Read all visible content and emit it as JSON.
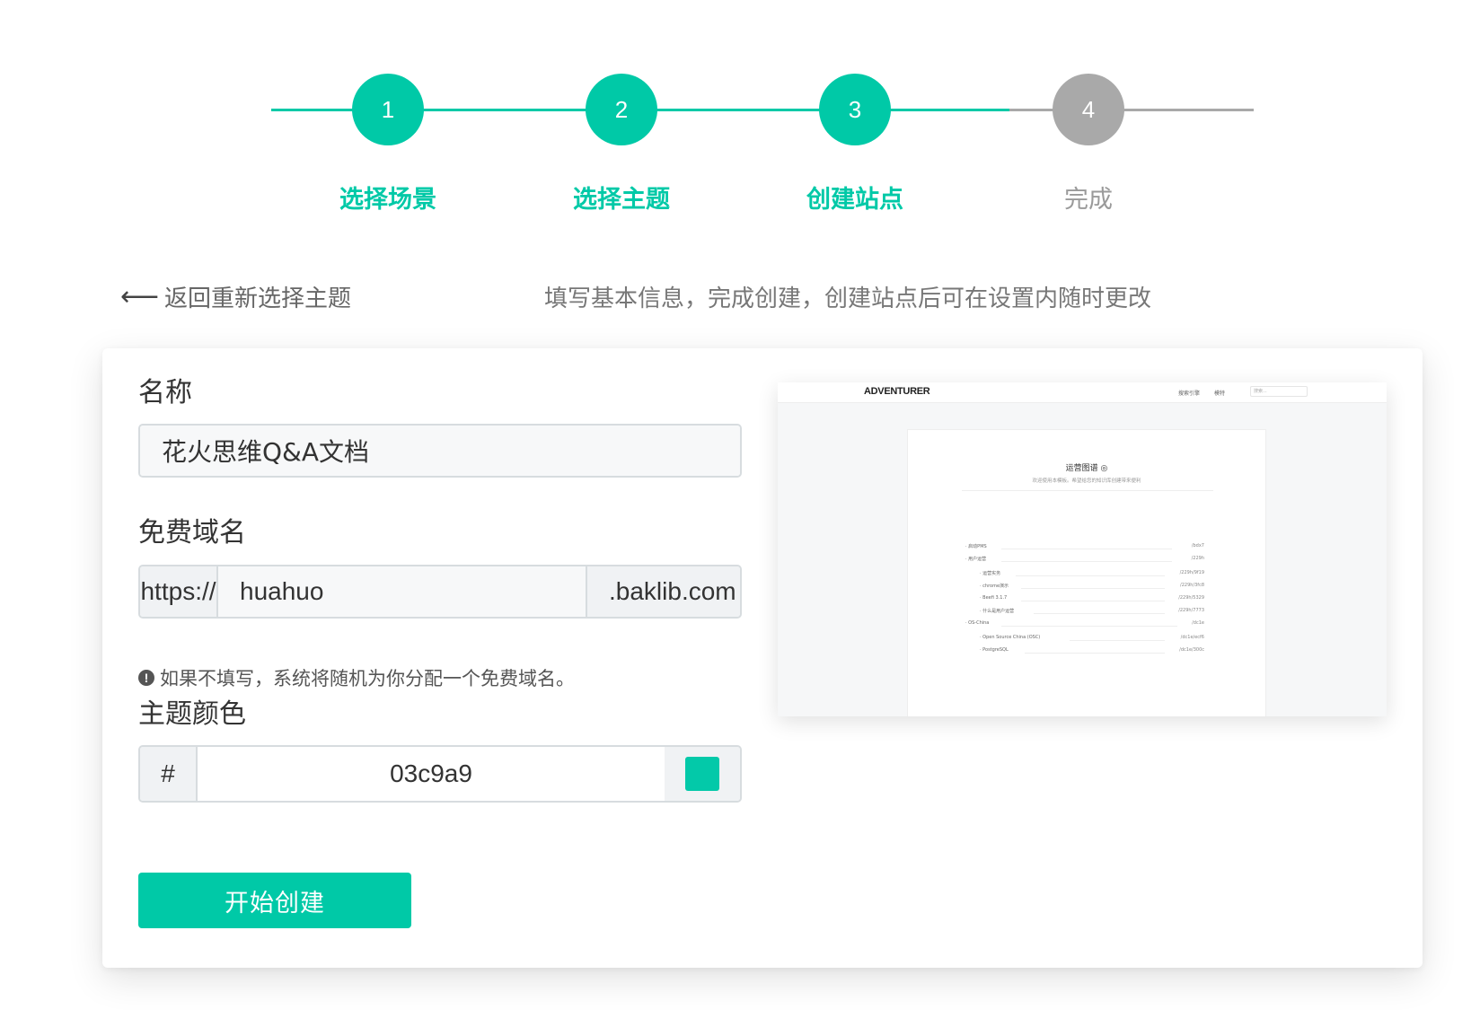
{
  "stepper": {
    "steps": [
      {
        "number": "1",
        "label": "选择场景",
        "status": "active"
      },
      {
        "number": "2",
        "label": "选择主题",
        "status": "active"
      },
      {
        "number": "3",
        "label": "创建站点",
        "status": "active"
      },
      {
        "number": "4",
        "label": "完成",
        "status": "pending"
      }
    ]
  },
  "header": {
    "back_arrow": "⟵",
    "back_label": "返回重新选择主题",
    "hint": "填写基本信息，完成创建，创建站点后可在设置内随时更改"
  },
  "form": {
    "name_label": "名称",
    "name_value": "花火思维Q&A文档",
    "domain_label": "免费域名",
    "domain_prefix": "https://",
    "domain_value": "huahuo",
    "domain_suffix": ".baklib.com",
    "domain_note_icon": "!",
    "domain_note": "如果不填写，系统将随机为你分配一个免费域名。",
    "color_label": "主题颜色",
    "color_hash": "#",
    "color_value": "03c9a9",
    "submit_label": "开始创建"
  },
  "preview": {
    "brand": "ADVENTURER",
    "nav_items": [
      "搜索引擎",
      "模特"
    ],
    "search_placeholder": "搜索...",
    "title": "运营图谱 ◎",
    "subtitle": "欢迎使用本模板。希望给您的知识库创建带来便利",
    "items": [
      {
        "label": "· 启动PMS",
        "code": "/bdx7"
      },
      {
        "label": "· 用户运营",
        "code": "/229h"
      },
      {
        "label": "· 运营实务",
        "code": "/229h/9f19"
      },
      {
        "label": "· chrome演示",
        "code": "/229h/3fc8"
      },
      {
        "label": "· Beefi 3.1.7",
        "code": "/229h/5329"
      },
      {
        "label": "· 什么是用户运营",
        "code": "/229h/7773"
      },
      {
        "label": "· OS-China",
        "code": "/dc1e"
      },
      {
        "label": "· Open Source China (OSC)",
        "code": "/dc1e/ecf6"
      },
      {
        "label": "· PostgreSQL",
        "code": "/dc1e/300c"
      }
    ]
  },
  "colors": {
    "accent": "#00c9a7",
    "swatch": "#03c9a9",
    "pending": "#a9a9a9"
  },
  "icons": {
    "back": "arrow-left-icon",
    "note": "info-icon"
  }
}
